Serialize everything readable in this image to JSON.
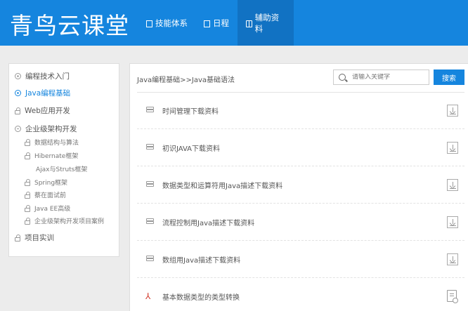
{
  "header": {
    "logo": "青鸟云课堂",
    "nav": [
      {
        "label": "技能体系",
        "icon": "list-icon"
      },
      {
        "label": "日程",
        "icon": "calendar-icon"
      },
      {
        "label": "辅助资料",
        "icon": "book-icon",
        "active": true
      }
    ],
    "brand_color": "#1585de"
  },
  "sidebar": {
    "items": [
      {
        "label": "编程技术入门",
        "icon": "plus-circle-icon"
      },
      {
        "label": "Java编程基础",
        "icon": "plus-circle-icon",
        "active": true
      },
      {
        "label": "Web应用开发",
        "icon": "lock-icon"
      },
      {
        "label": "企业级架构开发",
        "icon": "minus-circle-icon"
      },
      {
        "label": "数据结构与算法",
        "icon": "lock-icon"
      },
      {
        "label": "Hibernate框架",
        "icon": "lock-icon"
      },
      {
        "label": "Ajax与Struts框架",
        "icon": ""
      },
      {
        "label": "Spring框架",
        "icon": "lock-icon"
      },
      {
        "label": "蔡在面试前",
        "icon": "lock-icon"
      },
      {
        "label": "Java EE高级",
        "icon": "lock-icon"
      },
      {
        "label": "企业级架构开发项目案例",
        "icon": "lock-icon"
      },
      {
        "label": "项目实训",
        "icon": "lock-icon"
      }
    ]
  },
  "main": {
    "breadcrumb": "Java编程基础>>Java基础语法",
    "search": {
      "placeholder": "请输入关键字",
      "button": "搜索"
    },
    "resources": [
      {
        "title": "时间管理下载资料",
        "type": "stack",
        "action": "download-icon"
      },
      {
        "title": "初识JAVA下载资料",
        "type": "stack",
        "action": "download-icon"
      },
      {
        "title": "数据类型和运算符用Java描述下载资料",
        "type": "stack",
        "action": "download-icon"
      },
      {
        "title": "流程控制用Java描述下载资料",
        "type": "stack",
        "action": "download-icon"
      },
      {
        "title": "数组用Java描述下载资料",
        "type": "stack",
        "action": "download-icon"
      },
      {
        "title": "基本数据类型的类型转换",
        "type": "pdf",
        "action": "view-doc-icon"
      }
    ]
  }
}
